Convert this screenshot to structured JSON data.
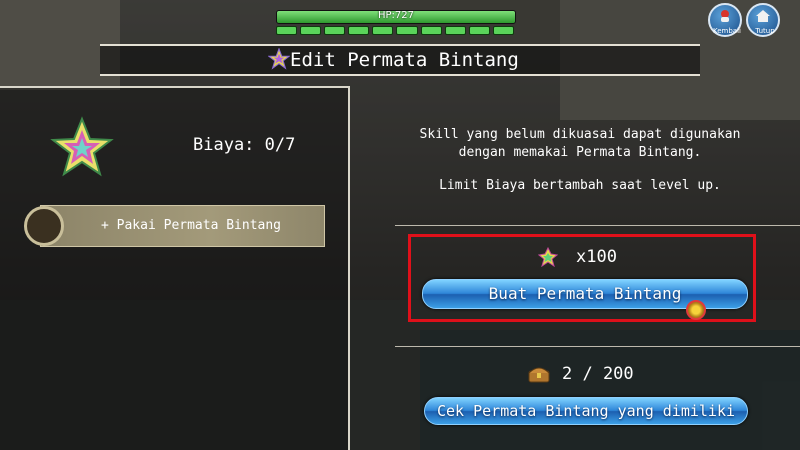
{
  "hud": {
    "hp_text": "HP:727",
    "hp_fraction": 1.0,
    "sp_segments_total": 10,
    "sp_segments_filled": 10
  },
  "top_buttons": {
    "kembali_label": "Kembali",
    "tutup_label": "Tutup"
  },
  "dialog": {
    "title": "Edit Permata Bintang",
    "cost_label": "Biaya: 0/7",
    "use_slot_label": "+ Pakai Permata Bintang",
    "info_line1": "Skill yang belum dikuasai dapat digunakan",
    "info_line2": "dengan memakai Permata Bintang.",
    "info_line3": "Limit Biaya bertambah saat level up.",
    "create_cost": "x100",
    "create_button": "Buat Permata Bintang",
    "owned_count": "2 / 200",
    "check_button": "Cek Permata Bintang yang dimiliki"
  },
  "colors": {
    "highlight": "#e0101a",
    "button_blue": "#2e86d8",
    "hp_green": "#5ad35a"
  },
  "icons": {
    "title": "star-gem-icon",
    "big": "star-gem-icon",
    "cost": "gem-icon",
    "capacity": "chest-icon"
  }
}
